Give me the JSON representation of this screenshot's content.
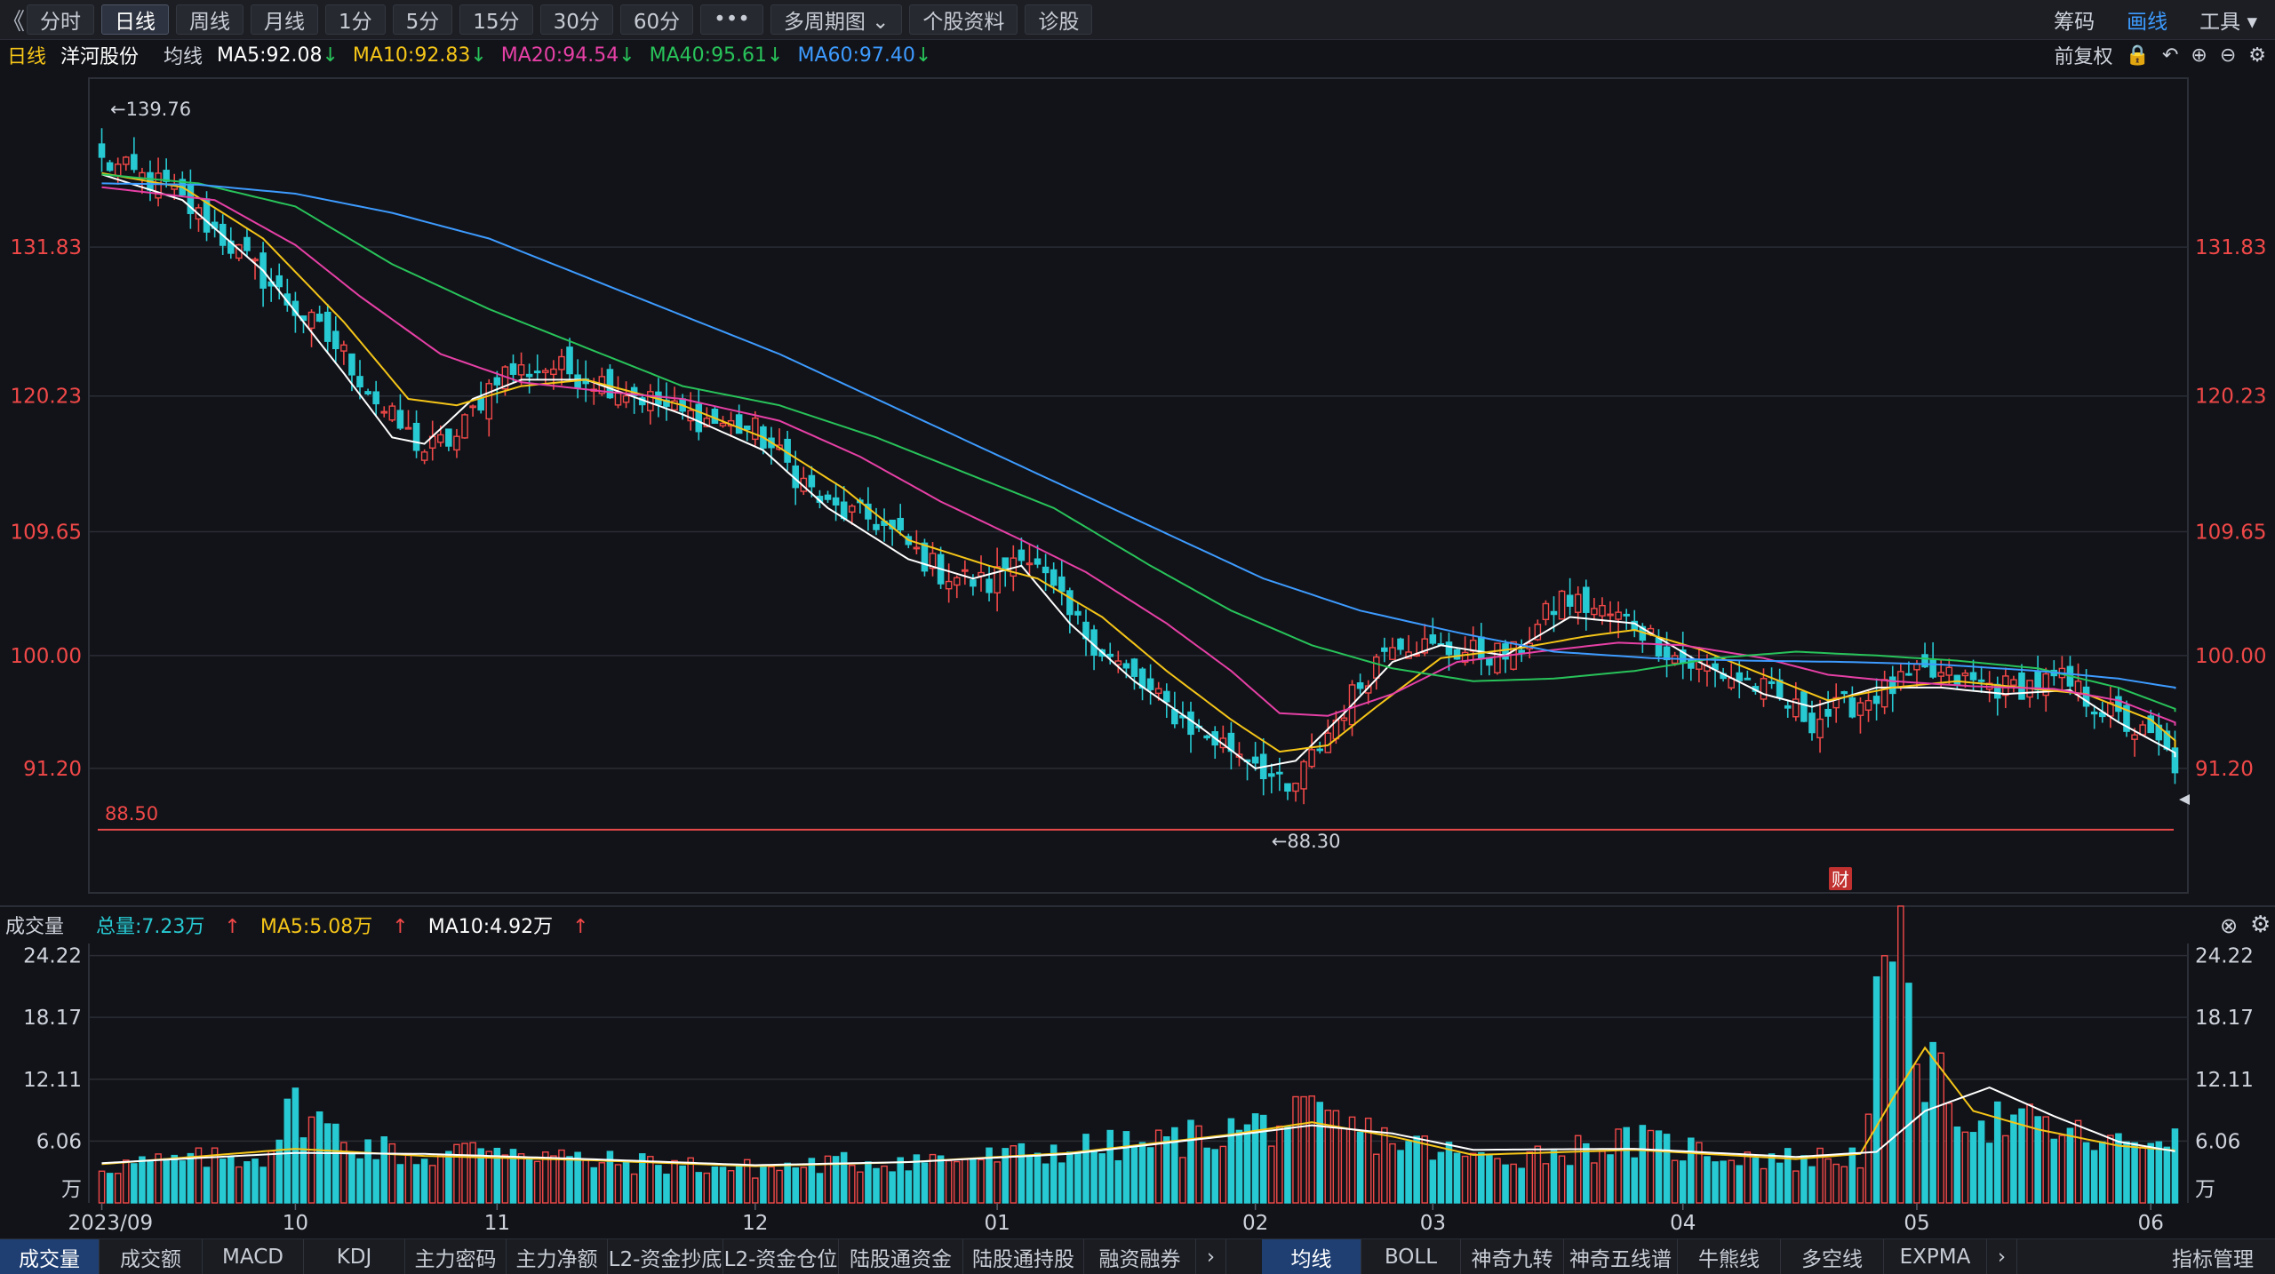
{
  "toolbar": {
    "back": "《",
    "buttons": [
      "分时",
      "日线",
      "周线",
      "月线",
      "1分",
      "5分",
      "15分",
      "30分",
      "60分",
      "•••",
      "多周期图",
      "个股资料",
      "诊股"
    ],
    "active": 1,
    "right": [
      "筹码",
      "画线",
      "工具"
    ],
    "right_active": 1
  },
  "info": {
    "period": "日线",
    "stock": "洋河股份",
    "ma_label": "均线",
    "ma": [
      {
        "text": "MA5:92.08",
        "color": "#ffffff"
      },
      {
        "text": "MA10:92.83",
        "color": "#f5c518"
      },
      {
        "text": "MA20:94.54",
        "color": "#e640a6"
      },
      {
        "text": "MA40:95.61",
        "color": "#28c35a"
      },
      {
        "text": "MA60:97.40",
        "color": "#3d9bff"
      }
    ],
    "adjust": "前复权"
  },
  "volume": {
    "title": "成交量",
    "total": "总量:7.23万",
    "ma5": "MA5:5.08万",
    "ma10": "MA10:4.92万"
  },
  "chart_data": {
    "type": "candlestick",
    "price_ticks": [
      "131.83",
      "120.23",
      "109.65",
      "100.00",
      "91.20"
    ],
    "price_tick_values": [
      131.83,
      120.23,
      109.65,
      100.0,
      91.2
    ],
    "ylim": [
      81.5,
      145.0
    ],
    "high_label": "←139.76",
    "low_label": "←88.30",
    "ref_line": {
      "value": 88.5,
      "label": "88.50"
    },
    "x_ticks": [
      "2023/09",
      "10",
      "11",
      "12",
      "01",
      "02",
      "03",
      "04",
      "05",
      "06"
    ],
    "x_tick_index": [
      0,
      24,
      49,
      81,
      111,
      143,
      165,
      196,
      225,
      254
    ],
    "n_bars": 258,
    "price_anchors": [
      [
        0,
        138.5
      ],
      [
        8,
        136.5
      ],
      [
        16,
        132.0
      ],
      [
        24,
        127.0
      ],
      [
        30,
        123.5
      ],
      [
        35,
        119.0
      ],
      [
        40,
        116.0
      ],
      [
        44,
        117.0
      ],
      [
        49,
        122.0
      ],
      [
        56,
        122.5
      ],
      [
        64,
        121.0
      ],
      [
        72,
        118.8
      ],
      [
        81,
        117.5
      ],
      [
        90,
        111.5
      ],
      [
        96,
        110.5
      ],
      [
        104,
        106.5
      ],
      [
        110,
        105.5
      ],
      [
        114,
        108.5
      ],
      [
        120,
        103.0
      ],
      [
        128,
        98.0
      ],
      [
        136,
        94.0
      ],
      [
        143,
        92.0
      ],
      [
        147,
        89.0
      ],
      [
        153,
        95.0
      ],
      [
        160,
        101.5
      ],
      [
        165,
        100.5
      ],
      [
        175,
        100.0
      ],
      [
        181,
        104.5
      ],
      [
        190,
        102.5
      ],
      [
        196,
        99.5
      ],
      [
        204,
        98.0
      ],
      [
        212,
        95.0
      ],
      [
        220,
        97.0
      ],
      [
        226,
        98.5
      ],
      [
        236,
        97.5
      ],
      [
        243,
        98.0
      ],
      [
        250,
        95.0
      ],
      [
        255,
        93.0
      ],
      [
        258,
        90.8
      ]
    ],
    "ma_series": [
      {
        "name": "MA5",
        "color": "#ffffff",
        "anchors": [
          [
            0,
            137.5
          ],
          [
            10,
            135.5
          ],
          [
            20,
            130.0
          ],
          [
            30,
            122.0
          ],
          [
            36,
            117.0
          ],
          [
            40,
            116.5
          ],
          [
            46,
            120.0
          ],
          [
            52,
            121.5
          ],
          [
            60,
            121.5
          ],
          [
            72,
            118.8
          ],
          [
            82,
            116.0
          ],
          [
            90,
            111.5
          ],
          [
            100,
            107.5
          ],
          [
            108,
            106.0
          ],
          [
            114,
            107.0
          ],
          [
            120,
            102.5
          ],
          [
            128,
            98.0
          ],
          [
            136,
            94.5
          ],
          [
            143,
            91.2
          ],
          [
            148,
            91.8
          ],
          [
            154,
            95.5
          ],
          [
            160,
            99.5
          ],
          [
            166,
            100.8
          ],
          [
            174,
            100.0
          ],
          [
            182,
            103.0
          ],
          [
            190,
            102.5
          ],
          [
            198,
            99.5
          ],
          [
            206,
            97.0
          ],
          [
            212,
            96.0
          ],
          [
            220,
            97.5
          ],
          [
            228,
            97.5
          ],
          [
            236,
            97.0
          ],
          [
            244,
            97.3
          ],
          [
            250,
            94.8
          ],
          [
            258,
            92.08
          ]
        ]
      },
      {
        "name": "MA10",
        "color": "#f5c518",
        "anchors": [
          [
            0,
            137.6
          ],
          [
            10,
            136.5
          ],
          [
            20,
            132.5
          ],
          [
            30,
            126.0
          ],
          [
            38,
            120.0
          ],
          [
            44,
            119.5
          ],
          [
            52,
            121.0
          ],
          [
            60,
            121.5
          ],
          [
            72,
            119.5
          ],
          [
            82,
            117.0
          ],
          [
            92,
            113.0
          ],
          [
            100,
            109.0
          ],
          [
            110,
            107.0
          ],
          [
            116,
            106.0
          ],
          [
            124,
            103.0
          ],
          [
            132,
            98.8
          ],
          [
            140,
            95.0
          ],
          [
            146,
            92.5
          ],
          [
            152,
            93.0
          ],
          [
            158,
            96.0
          ],
          [
            166,
            99.8
          ],
          [
            176,
            100.6
          ],
          [
            184,
            101.5
          ],
          [
            190,
            102.0
          ],
          [
            198,
            100.5
          ],
          [
            206,
            98.5
          ],
          [
            214,
            96.5
          ],
          [
            222,
            97.5
          ],
          [
            230,
            98.0
          ],
          [
            238,
            97.5
          ],
          [
            246,
            97.0
          ],
          [
            254,
            95.0
          ],
          [
            258,
            92.83
          ]
        ]
      },
      {
        "name": "MA20",
        "color": "#e640a6",
        "anchors": [
          [
            0,
            136.5
          ],
          [
            14,
            135.5
          ],
          [
            24,
            132.0
          ],
          [
            32,
            128.0
          ],
          [
            42,
            123.5
          ],
          [
            52,
            121.3
          ],
          [
            62,
            120.6
          ],
          [
            72,
            120.0
          ],
          [
            84,
            118.3
          ],
          [
            94,
            115.5
          ],
          [
            104,
            112.0
          ],
          [
            114,
            109.0
          ],
          [
            122,
            106.5
          ],
          [
            132,
            102.5
          ],
          [
            140,
            98.8
          ],
          [
            146,
            95.5
          ],
          [
            152,
            95.3
          ],
          [
            160,
            97.0
          ],
          [
            168,
            99.5
          ],
          [
            178,
            100.3
          ],
          [
            188,
            101.0
          ],
          [
            196,
            100.8
          ],
          [
            206,
            99.8
          ],
          [
            214,
            98.5
          ],
          [
            222,
            98.0
          ],
          [
            232,
            97.6
          ],
          [
            242,
            97.4
          ],
          [
            250,
            96.5
          ],
          [
            258,
            94.54
          ]
        ]
      },
      {
        "name": "MA40",
        "color": "#28c35a",
        "anchors": [
          [
            0,
            137.5
          ],
          [
            12,
            136.8
          ],
          [
            24,
            135.0
          ],
          [
            36,
            130.5
          ],
          [
            48,
            127.0
          ],
          [
            60,
            124.0
          ],
          [
            72,
            121.0
          ],
          [
            84,
            119.5
          ],
          [
            96,
            117.0
          ],
          [
            108,
            114.0
          ],
          [
            118,
            111.5
          ],
          [
            130,
            107.0
          ],
          [
            140,
            103.5
          ],
          [
            150,
            100.8
          ],
          [
            160,
            99.0
          ],
          [
            170,
            98.0
          ],
          [
            180,
            98.2
          ],
          [
            190,
            98.8
          ],
          [
            200,
            99.8
          ],
          [
            210,
            100.3
          ],
          [
            220,
            100.0
          ],
          [
            230,
            99.6
          ],
          [
            240,
            99.0
          ],
          [
            250,
            97.5
          ],
          [
            258,
            95.61
          ]
        ]
      },
      {
        "name": "MA60",
        "color": "#3d9bff",
        "anchors": [
          [
            0,
            136.8
          ],
          [
            12,
            136.7
          ],
          [
            24,
            136.0
          ],
          [
            36,
            134.5
          ],
          [
            48,
            132.5
          ],
          [
            60,
            129.5
          ],
          [
            72,
            126.5
          ],
          [
            84,
            123.5
          ],
          [
            96,
            120.0
          ],
          [
            108,
            116.5
          ],
          [
            120,
            113.0
          ],
          [
            132,
            109.5
          ],
          [
            144,
            106.0
          ],
          [
            156,
            103.5
          ],
          [
            168,
            101.8
          ],
          [
            180,
            100.3
          ],
          [
            192,
            99.8
          ],
          [
            204,
            99.6
          ],
          [
            216,
            99.5
          ],
          [
            228,
            99.3
          ],
          [
            240,
            98.8
          ],
          [
            250,
            98.2
          ],
          [
            258,
            97.4
          ]
        ]
      }
    ],
    "volume_ticks": [
      "24.22",
      "18.17",
      "12.11",
      "6.06"
    ],
    "volume_tick_values": [
      24.22,
      18.17,
      12.11,
      6.06
    ],
    "volume_unit": "万",
    "volume_ylim": [
      0,
      25.4
    ],
    "volume_anchors": [
      [
        0,
        3.6
      ],
      [
        20,
        4.6
      ],
      [
        24,
        9.5
      ],
      [
        30,
        6.2
      ],
      [
        40,
        4.3
      ],
      [
        49,
        5.8
      ],
      [
        60,
        4.0
      ],
      [
        70,
        3.8
      ],
      [
        81,
        3.3
      ],
      [
        92,
        3.9
      ],
      [
        100,
        4.2
      ],
      [
        111,
        4.4
      ],
      [
        120,
        5.3
      ],
      [
        130,
        5.7
      ],
      [
        143,
        7.5
      ],
      [
        150,
        8.2
      ],
      [
        160,
        6.2
      ],
      [
        170,
        4.3
      ],
      [
        180,
        5.0
      ],
      [
        190,
        6.0
      ],
      [
        200,
        4.9
      ],
      [
        210,
        4.2
      ],
      [
        218,
        4.6
      ],
      [
        221,
        24.2
      ],
      [
        224,
        21.5
      ],
      [
        226,
        13.0
      ],
      [
        232,
        8.3
      ],
      [
        240,
        7.5
      ],
      [
        250,
        5.5
      ],
      [
        257,
        7.23
      ]
    ],
    "volume_ma": [
      {
        "name": "MA5",
        "color": "#f5c518",
        "anchors": [
          [
            0,
            3.8
          ],
          [
            24,
            5.3
          ],
          [
            40,
            4.6
          ],
          [
            60,
            4.2
          ],
          [
            81,
            3.6
          ],
          [
            100,
            4.0
          ],
          [
            120,
            4.9
          ],
          [
            140,
            6.7
          ],
          [
            150,
            7.9
          ],
          [
            160,
            6.5
          ],
          [
            170,
            4.7
          ],
          [
            190,
            5.2
          ],
          [
            210,
            4.3
          ],
          [
            218,
            4.8
          ],
          [
            222,
            10.2
          ],
          [
            226,
            15.2
          ],
          [
            232,
            9.0
          ],
          [
            240,
            7.2
          ],
          [
            250,
            5.6
          ],
          [
            258,
            5.08
          ]
        ]
      },
      {
        "name": "MA10",
        "color": "#ffffff",
        "anchors": [
          [
            0,
            3.9
          ],
          [
            24,
            4.9
          ],
          [
            40,
            4.8
          ],
          [
            60,
            4.3
          ],
          [
            81,
            3.7
          ],
          [
            100,
            4.0
          ],
          [
            120,
            4.8
          ],
          [
            140,
            6.6
          ],
          [
            150,
            7.6
          ],
          [
            160,
            6.8
          ],
          [
            170,
            5.2
          ],
          [
            190,
            5.3
          ],
          [
            210,
            4.5
          ],
          [
            220,
            5.0
          ],
          [
            226,
            9.0
          ],
          [
            234,
            11.3
          ],
          [
            242,
            8.5
          ],
          [
            250,
            6.0
          ],
          [
            258,
            4.92
          ]
        ]
      }
    ],
    "special_marker": "财"
  },
  "bottom_tabs_left": [
    "成交量",
    "成交额",
    "MACD",
    "KDJ",
    "主力密码",
    "主力净额",
    "L2-资金抄底",
    "L2-资金仓位",
    "陆股通资金",
    "陆股通持股",
    "融资融券"
  ],
  "bottom_tabs_right": [
    "均线",
    "BOLL",
    "神奇九转",
    "神奇五线谱",
    "牛熊线",
    "多空线",
    "EXPMA"
  ],
  "bottom_tab_more": "›",
  "bottom_tab_end": "指标管理"
}
